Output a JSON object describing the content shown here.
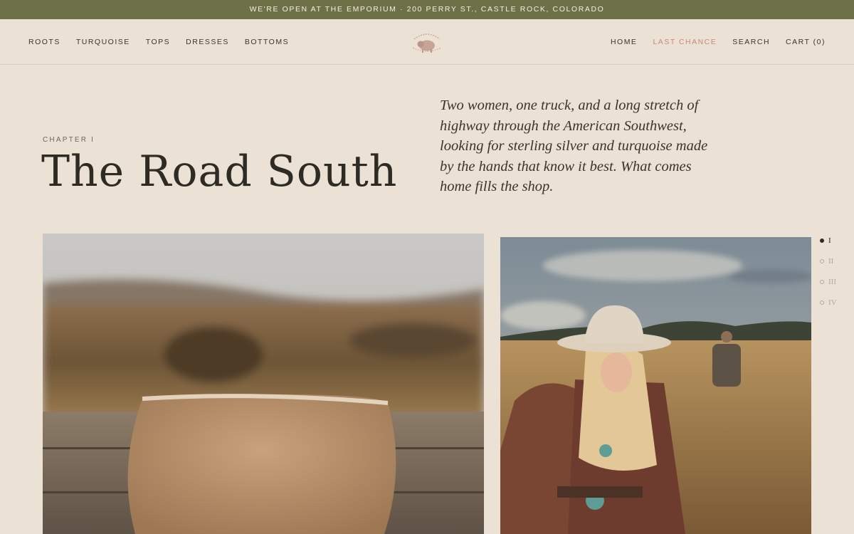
{
  "announcement": {
    "text": "WE'RE OPEN AT THE EMPORIUM · 200 PERRY ST., CASTLE ROCK, COLORADO"
  },
  "nav": {
    "left": [
      {
        "label": "ROOTS"
      },
      {
        "label": "TURQUOISE"
      },
      {
        "label": "TOPS"
      },
      {
        "label": "DRESSES"
      },
      {
        "label": "BOTTOMS"
      }
    ],
    "right": [
      {
        "label": "HOME"
      },
      {
        "label": "LAST CHANCE"
      },
      {
        "label": "SEARCH"
      },
      {
        "label": "CART (0)"
      }
    ]
  },
  "logo": {
    "icon": "bison-emblem-icon"
  },
  "hero": {
    "eyebrow": "CHAPTER I",
    "title": "The Road South",
    "intro": "Two women, one truck, and a long stretch of highway through the American Southwest, looking for sterling silver and turquoise made by the hands that know it best. What comes home fills the shop."
  },
  "photos": {
    "left": {
      "subject": "sheepskin-bag-on-fence"
    },
    "right": {
      "subject": "cowgirl-in-field"
    }
  },
  "pager": {
    "items": [
      {
        "label": "I",
        "active": true
      },
      {
        "label": "II",
        "active": false
      },
      {
        "label": "III",
        "active": false
      },
      {
        "label": "IV",
        "active": false
      }
    ]
  },
  "colors": {
    "announcement_bg": "#6e7048",
    "page_bg": "#ebe1d4",
    "accent": "#c9887a",
    "text": "#2e2a24"
  }
}
